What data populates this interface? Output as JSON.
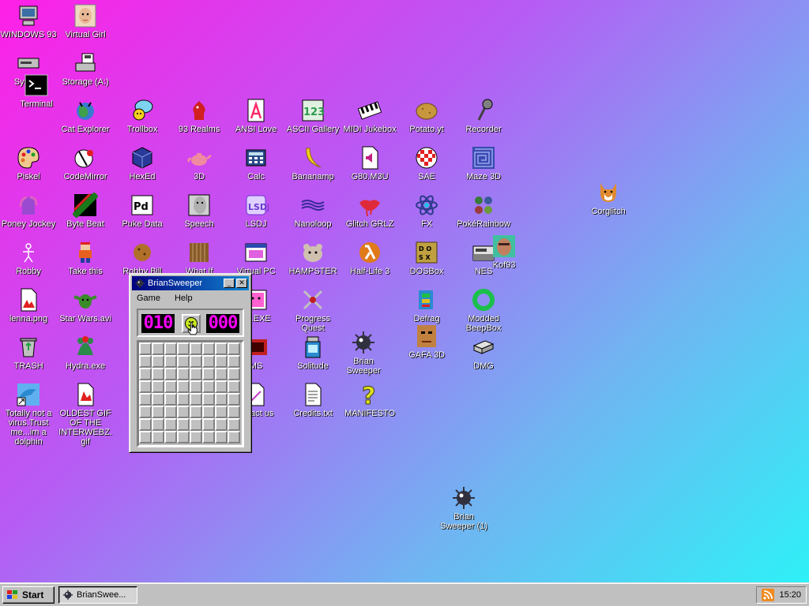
{
  "desktop_icons": [
    {
      "label": "WINDOWS 93",
      "icon": "computer-icon",
      "color": "#3a6ea5"
    },
    {
      "label": "Virtual Girl",
      "icon": "girl-face-icon",
      "color": "#e8b896"
    },
    {
      "label": "System",
      "icon": "disk-drive-icon",
      "color": "#c0c0c0"
    },
    {
      "label": "Storage (A:)",
      "icon": "floppy-drive-icon",
      "color": "#c0c0c0"
    },
    {
      "label": "Terminal",
      "icon": "terminal-icon",
      "color": "#000000"
    },
    {
      "label": "Cat Explorer",
      "icon": "globe-cat-icon",
      "color": "#3fa14a"
    },
    {
      "label": "Trollbox",
      "icon": "chat-bubble-icon",
      "color": "#7dd3f0"
    },
    {
      "label": "93 Realms",
      "icon": "knight-icon",
      "color": "#d02020"
    },
    {
      "label": "ANSI Love",
      "icon": "letter-a-icon",
      "color": "#ff2a6a"
    },
    {
      "label": "ASCII Gallery",
      "icon": "123-icon",
      "color": "#2a9a4a"
    },
    {
      "label": "MIDI Jukebox",
      "icon": "piano-icon",
      "color": "#000000"
    },
    {
      "label": "Potato.yt",
      "icon": "potato-icon",
      "color": "#c8963c"
    },
    {
      "label": "Recorder",
      "icon": "microphone-icon",
      "color": "#808080"
    },
    {
      "label": "Piskel",
      "icon": "palette-icon",
      "color": "#e07030"
    },
    {
      "label": "CodeMirror",
      "icon": "codemirror-icon",
      "color": "#ffffff"
    },
    {
      "label": "HexEd",
      "icon": "cube-icon",
      "color": "#2a3a9a"
    },
    {
      "label": "3D",
      "icon": "teapot-icon",
      "color": "#f08aa0"
    },
    {
      "label": "Calc",
      "icon": "calculator-icon",
      "color": "#2a4a8a"
    },
    {
      "label": "Bananamp",
      "icon": "banana-icon",
      "color": "#f4d020"
    },
    {
      "label": "G80.M3U",
      "icon": "audio-file-icon",
      "color": "#ffffff"
    },
    {
      "label": "SAE",
      "icon": "amiga-ball-icon",
      "color": "#e02020"
    },
    {
      "label": "Maze 3D",
      "icon": "maze-icon",
      "color": "#3a4ab0"
    },
    {
      "label": "Corglitch",
      "icon": "corgi-icon",
      "color": "#e08a30"
    },
    {
      "label": "Poney Jockey",
      "icon": "pony-icon",
      "color": "#9a4ad0"
    },
    {
      "label": "Byte Beat",
      "icon": "byte-beat-icon",
      "color": "#1a7a1a"
    },
    {
      "label": "Puke Data",
      "icon": "pd-icon",
      "color": "#ffffff"
    },
    {
      "label": "Speech",
      "icon": "face-speech-icon",
      "color": "#d0d0d0"
    },
    {
      "label": "LSDJ",
      "icon": "lsdj-icon",
      "color": "#6a3ad0"
    },
    {
      "label": "Nanoloop",
      "icon": "waves-icon",
      "color": "#3a2a9a"
    },
    {
      "label": "Glitch GRLZ",
      "icon": "lips-icon",
      "color": "#e02a3a"
    },
    {
      "label": "FX",
      "icon": "atom-icon",
      "color": "#2a3a8a"
    },
    {
      "label": "PokéRainbow",
      "icon": "pokemon-group-icon",
      "color": "#3a7a3a"
    },
    {
      "label": "Robby",
      "icon": "stick-figure-icon",
      "color": "#ffffff"
    },
    {
      "label": "Take this",
      "icon": "pixel-man-icon",
      "color": "#e86020"
    },
    {
      "label": "Robby Bill",
      "icon": "cookie-icon",
      "color": "#b0702a"
    },
    {
      "label": "What If",
      "icon": "what-if-icon",
      "color": "#8a5a2a"
    },
    {
      "label": "Virtual PC",
      "icon": "window-icon",
      "color": "#2a4ab0"
    },
    {
      "label": "HAMPSTER",
      "icon": "hamster-icon",
      "color": "#d0c0b0"
    },
    {
      "label": "Half-Life 3",
      "icon": "lambda-icon",
      "color": "#e07a1a"
    },
    {
      "label": "DOSBox",
      "icon": "dosbox-icon",
      "color": "#c0a040"
    },
    {
      "label": "NES",
      "icon": "nes-icon",
      "color": "#e0e0e0"
    },
    {
      "label": "Kof93",
      "icon": "fighter-face-icon",
      "color": "#c08060"
    },
    {
      "label": "lenna.png",
      "icon": "image-file-icon",
      "color": "#e02020"
    },
    {
      "label": "Star Wars.avi",
      "icon": "yoda-icon",
      "color": "#3a8a2a"
    },
    {
      "label": "32.EXE",
      "icon": "exe-face-icon",
      "color": "#ff60d0"
    },
    {
      "label": "Progress Quest",
      "icon": "swords-icon",
      "color": "#c02020"
    },
    {
      "label": "Defrag",
      "icon": "defrag-icon",
      "color": "#2a8ad0"
    },
    {
      "label": "Modded BeepBox",
      "icon": "ring-icon",
      "color": "#1ac04a"
    },
    {
      "label": "TRASH",
      "icon": "recycle-bin-icon",
      "color": "#c0c0c0"
    },
    {
      "label": "Hydra.exe",
      "icon": "hydra-icon",
      "color": "#2a8a4a"
    },
    {
      "label": "Ad",
      "icon": "ad-icon",
      "color": "#ffffff"
    },
    {
      "label": "MS",
      "icon": "ms-icon",
      "color": "#c02020"
    },
    {
      "label": "Solitude",
      "icon": "solitude-icon",
      "color": "#2a8ad0"
    },
    {
      "label": "Brian Sweeper",
      "icon": "mine-icon",
      "color": "#303040"
    },
    {
      "label": "GAFA 3D",
      "icon": "doom-face-icon",
      "color": "#c08040"
    },
    {
      "label": "DMG",
      "icon": "dmg-icon",
      "color": "#c0c0c0"
    },
    {
      "label": "Totally not a virus.Trust me...im a dolphin",
      "icon": "dolphin-icon",
      "color": "#2a8ad0"
    },
    {
      "label": "OLDEST GIF OF THE INTERWEBZ.gif",
      "icon": "gif-file-icon",
      "color": "#e02020"
    },
    {
      "label": "ontact us",
      "icon": "contact-icon",
      "color": "#ffffff"
    },
    {
      "label": "Credits.txt",
      "icon": "text-file-icon",
      "color": "#ffffff"
    },
    {
      "label": "MANIFESTO",
      "icon": "question-mark-icon",
      "color": "#e0e020"
    },
    {
      "label": "Brian Sweeper (1)",
      "icon": "mine-icon",
      "color": "#303040"
    }
  ],
  "window": {
    "title": "BrianSweeper",
    "menu": [
      "Game",
      "Help"
    ],
    "mines_counter": "010",
    "timer": "000",
    "grid_rows": 8,
    "grid_cols": 8,
    "lcd_color": "#ff00ff"
  },
  "taskbar": {
    "start_label": "Start",
    "task_label": "BrianSwee...",
    "clock": "15:20"
  }
}
